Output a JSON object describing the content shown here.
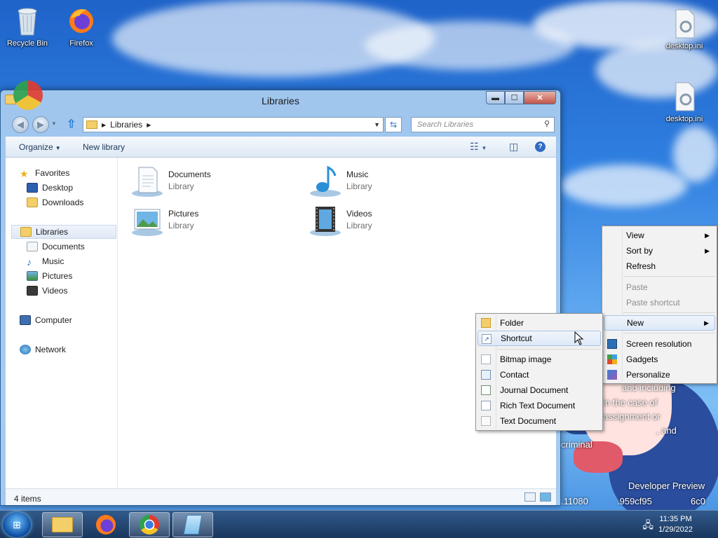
{
  "desktop": {
    "icons": [
      {
        "label": "Recycle Bin",
        "icon": "recycle-bin-icon"
      },
      {
        "label": "Firefox",
        "icon": "firefox-icon"
      },
      {
        "label": "desktop.ini",
        "icon": "settings-file-icon"
      },
      {
        "label": "desktop.ini",
        "icon": "settings-file-icon"
      }
    ],
    "wallpaper_text": [
      "and including",
      "in the case of",
      "assignment or",
      ", and",
      "criminal",
      "Developer Preview",
      ".11080",
      ".959cf95",
      "6c0"
    ]
  },
  "window": {
    "title": "Libraries",
    "address": {
      "root_icon": "library-folder-icon",
      "crumbs": [
        "Libraries"
      ]
    },
    "search": {
      "placeholder": "Search Libraries"
    },
    "commands": {
      "organize": "Organize",
      "new_library": "New library"
    },
    "nav": {
      "favorites": {
        "label": "Favorites",
        "items": [
          "Desktop",
          "Downloads"
        ]
      },
      "libraries": {
        "label": "Libraries",
        "items": [
          "Documents",
          "Music",
          "Pictures",
          "Videos"
        ]
      },
      "computer": "Computer",
      "network": "Network"
    },
    "libraries": [
      {
        "name": "Documents",
        "sub": "Library"
      },
      {
        "name": "Music",
        "sub": "Library"
      },
      {
        "name": "Pictures",
        "sub": "Library"
      },
      {
        "name": "Videos",
        "sub": "Library"
      }
    ],
    "status": "4 items"
  },
  "desktop_menu": {
    "items": [
      {
        "label": "View",
        "submenu": true,
        "enabled": true
      },
      {
        "label": "Sort by",
        "submenu": true,
        "enabled": true
      },
      {
        "label": "Refresh",
        "submenu": false,
        "enabled": true
      },
      {
        "label": "Paste",
        "submenu": false,
        "enabled": false
      },
      {
        "label": "Paste shortcut",
        "submenu": false,
        "enabled": false
      },
      {
        "label": "New",
        "submenu": true,
        "enabled": true,
        "highlighted": true
      },
      {
        "label": "Screen resolution",
        "submenu": false,
        "enabled": true
      },
      {
        "label": "Gadgets",
        "submenu": false,
        "enabled": true
      },
      {
        "label": "Personalize",
        "submenu": false,
        "enabled": true
      }
    ]
  },
  "new_menu": {
    "items": [
      {
        "label": "Folder",
        "icon": "folder-icon"
      },
      {
        "label": "Shortcut",
        "icon": "shortcut-icon",
        "highlighted": true
      },
      {
        "label": "Bitmap image",
        "icon": "bitmap-icon"
      },
      {
        "label": "Contact",
        "icon": "contact-icon"
      },
      {
        "label": "Journal Document",
        "icon": "journal-icon"
      },
      {
        "label": "Rich Text Document",
        "icon": "rtf-icon"
      },
      {
        "label": "Text Document",
        "icon": "text-document-icon"
      }
    ]
  },
  "taskbar": {
    "pinned": [
      "explorer-icon",
      "firefox-icon",
      "chrome-icon",
      "notepad-icon"
    ],
    "time": "11:35 PM",
    "date": "1/29/2022"
  }
}
